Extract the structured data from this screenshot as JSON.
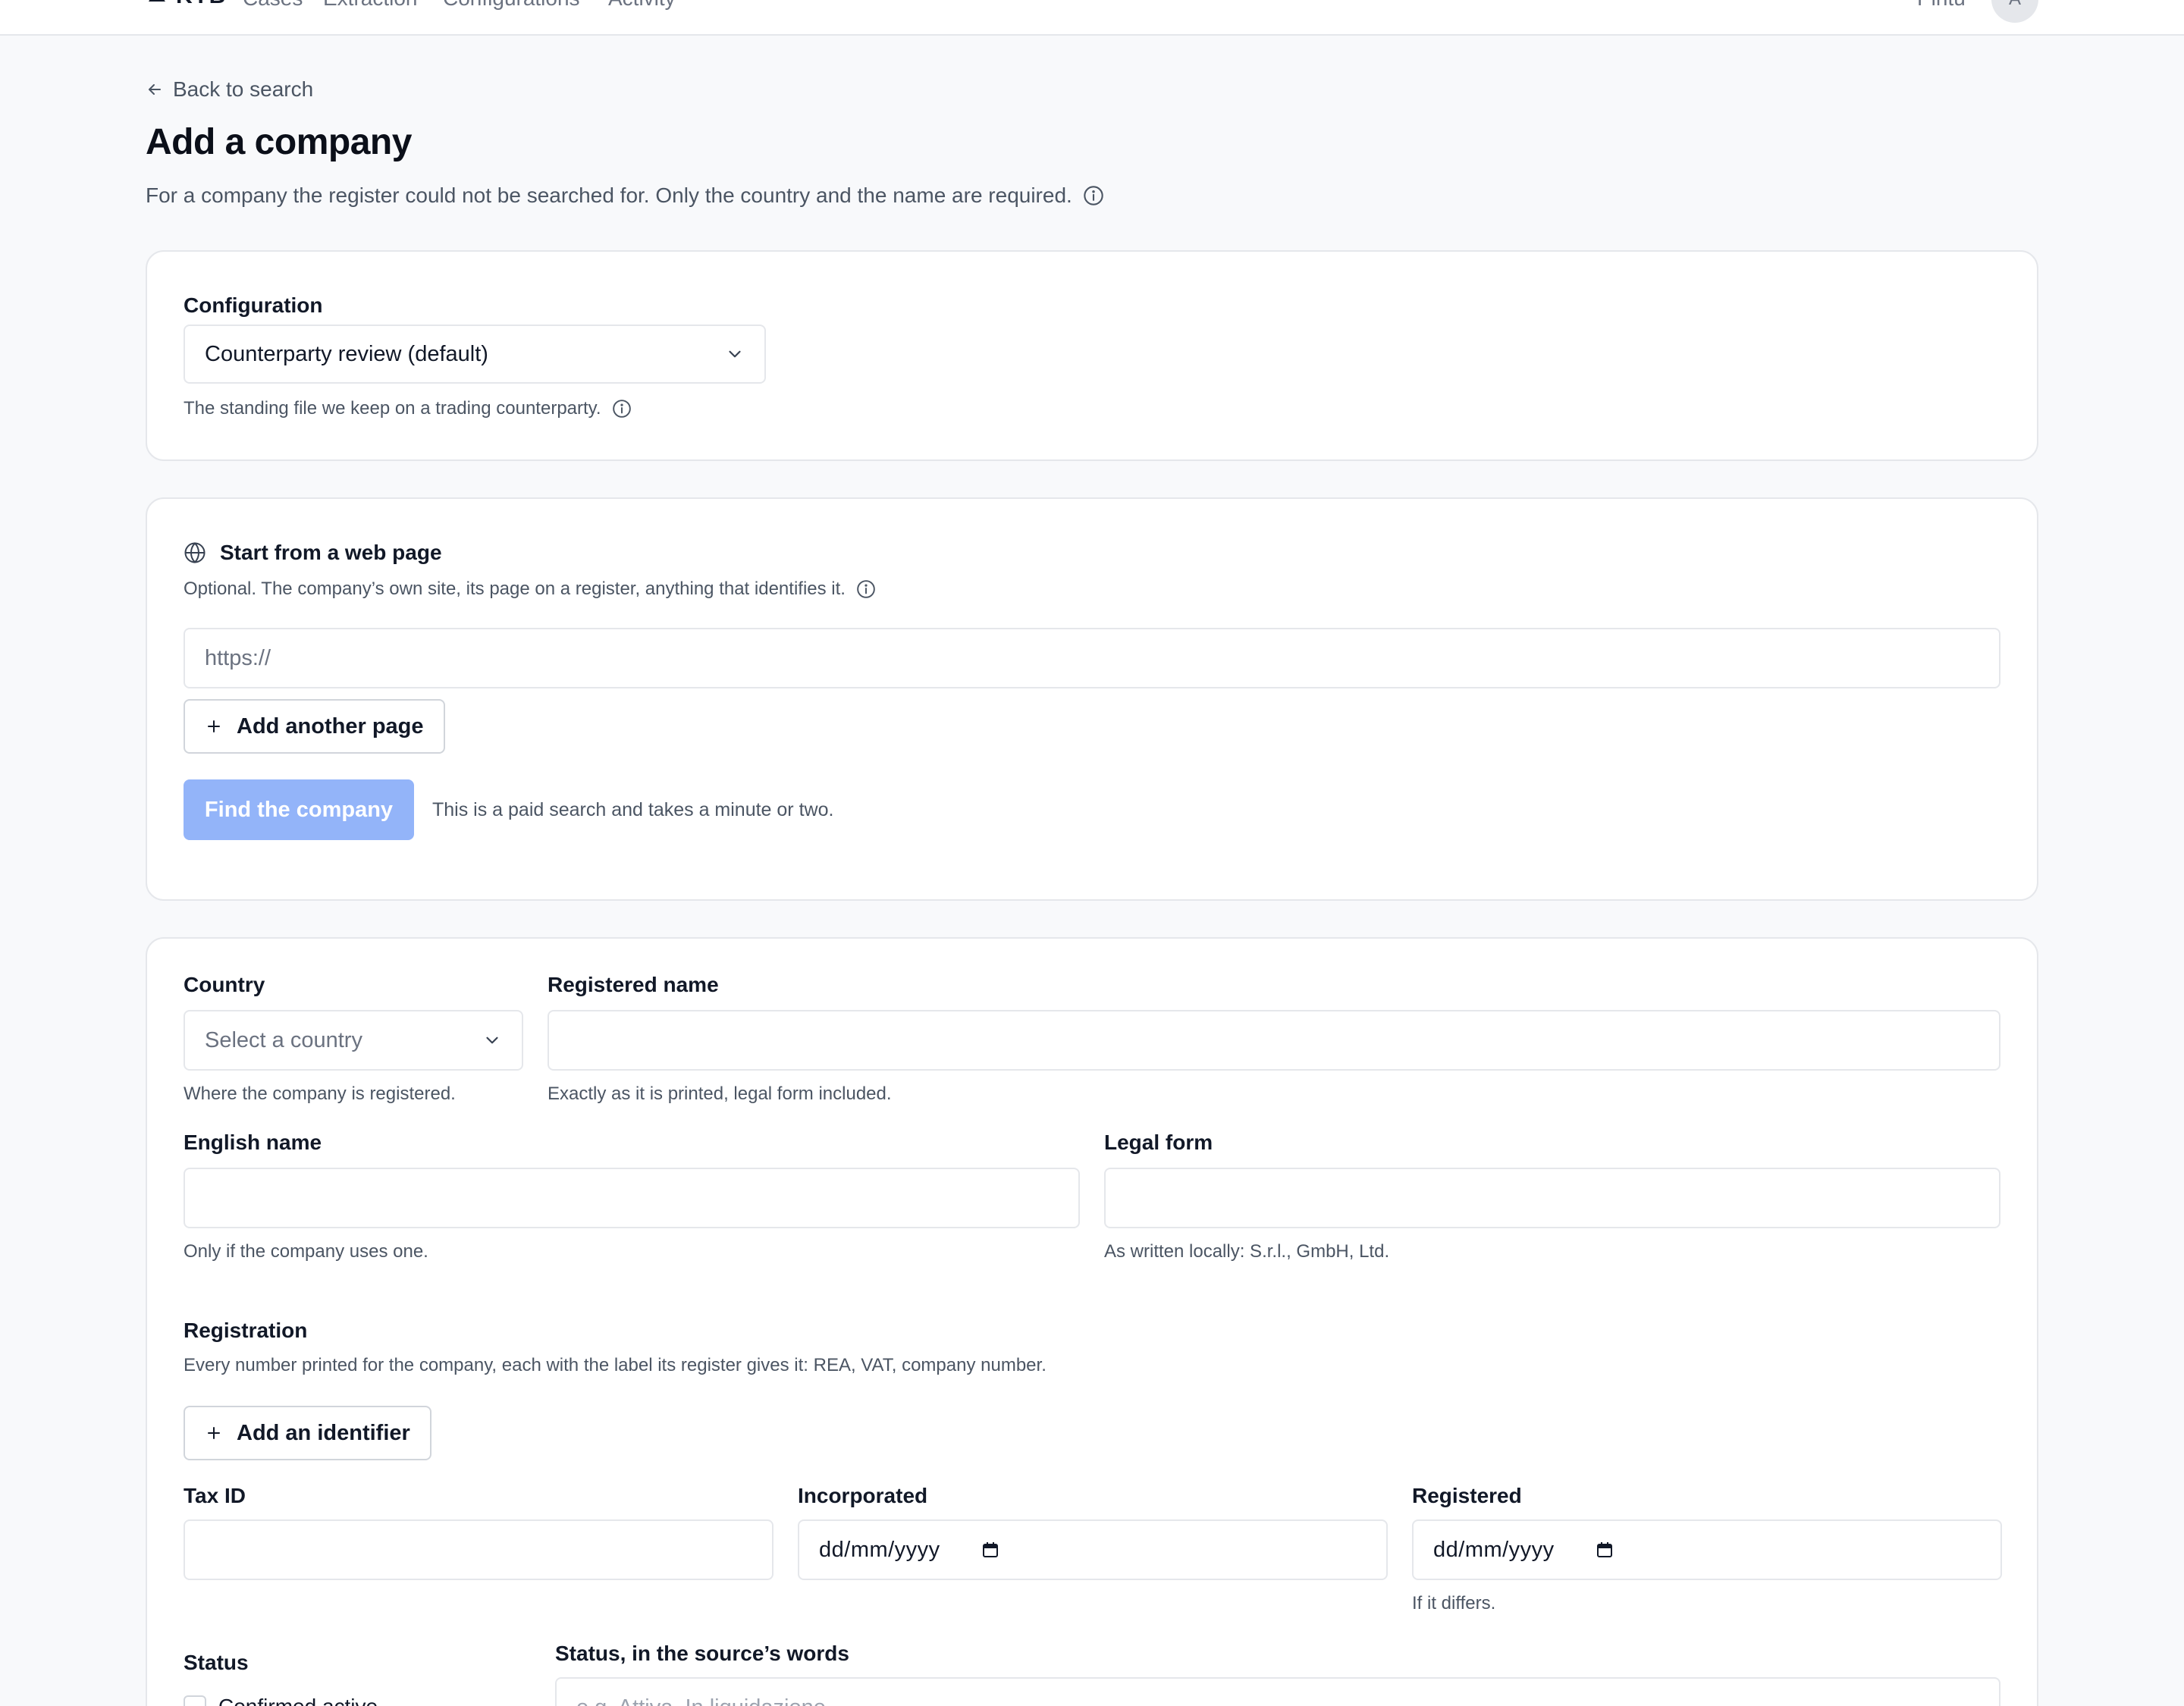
{
  "nav": {
    "brand": "KYB",
    "items": [
      "Cases",
      "Extraction",
      "Configurations",
      "Activity"
    ],
    "user_name": "Pintu",
    "avatar_initial": "A"
  },
  "header": {
    "back_label": "Back to search",
    "title": "Add a company",
    "description": "For a company the register could not be searched for. Only the country and the name are required."
  },
  "configuration": {
    "label": "Configuration",
    "selected": "Counterparty review (default)",
    "help": "The standing file we keep on a trading counterparty."
  },
  "web_page": {
    "title": "Start from a web page",
    "help": "Optional. The company’s own site, its page on a register, anything that identifies it.",
    "url_placeholder": "https://",
    "add_page_label": "Add another page",
    "find_label": "Find the company",
    "find_note": "This is a paid search and takes a minute or two."
  },
  "company": {
    "country_label": "Country",
    "country_placeholder": "Select a country",
    "country_help": "Where the company is registered.",
    "registered_name_label": "Registered name",
    "registered_name_help": "Exactly as it is printed, legal form included.",
    "english_name_label": "English name",
    "english_name_help": "Only if the company uses one.",
    "legal_form_label": "Legal form",
    "legal_form_help": "As written locally: S.r.l., GmbH, Ltd.",
    "registration_label": "Registration",
    "registration_help": "Every number printed for the company, each with the label its register gives it: REA, VAT, company number.",
    "add_identifier_label": "Add an identifier",
    "tax_id_label": "Tax ID",
    "incorporated_label": "Incorporated",
    "incorporated_value": "dd/mm/yyyy",
    "registered_label": "Registered",
    "registered_value": "dd/mm/yyyy",
    "registered_help": "If it differs.",
    "status_label": "Status",
    "status_option": "Confirmed active",
    "status_words_label": "Status, in the source’s words",
    "status_words_placeholder": "e.g. Attiva, In liquidazione"
  }
}
